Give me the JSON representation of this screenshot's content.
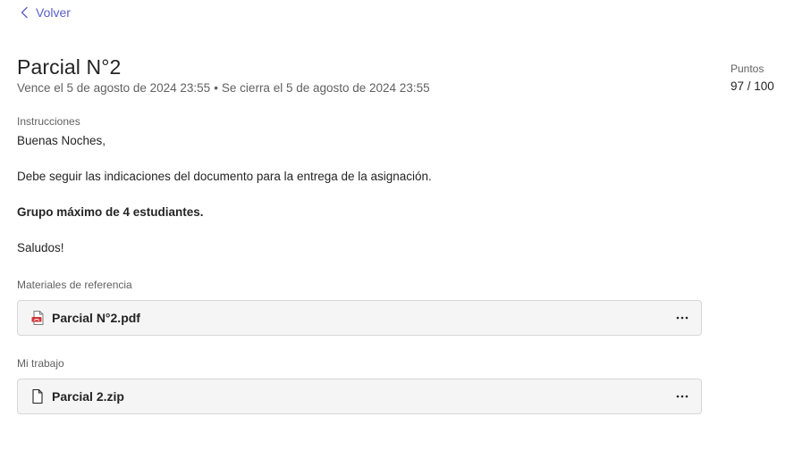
{
  "nav": {
    "back_label": "Volver"
  },
  "assignment": {
    "title": "Parcial N°2",
    "due_text": "Vence el 5 de agosto de 2024 23:55",
    "separator": "•",
    "close_text": "Se cierra el 5 de agosto de 2024 23:55"
  },
  "points": {
    "label": "Puntos",
    "value": "97 / 100"
  },
  "instructions": {
    "label": "Instrucciones",
    "lines": [
      "Buenas Noches,",
      "Debe seguir las indicaciones del documento para la entrega de la asignación.",
      "Grupo máximo de 4 estudiantes.",
      "Saludos!"
    ]
  },
  "reference_materials": {
    "label": "Materiales de referencia",
    "files": [
      {
        "name": "Parcial N°2.pdf",
        "icon": "pdf-file-icon"
      }
    ]
  },
  "my_work": {
    "label": "Mi trabajo",
    "files": [
      {
        "name": "Parcial 2.zip",
        "icon": "generic-file-icon"
      }
    ]
  },
  "colors": {
    "accent": "#5b5fc7",
    "text": "#242424",
    "secondary_text": "#616161",
    "card_bg": "#f5f5f5",
    "card_border": "#d6d6d6",
    "pdf_red": "#d13438"
  }
}
